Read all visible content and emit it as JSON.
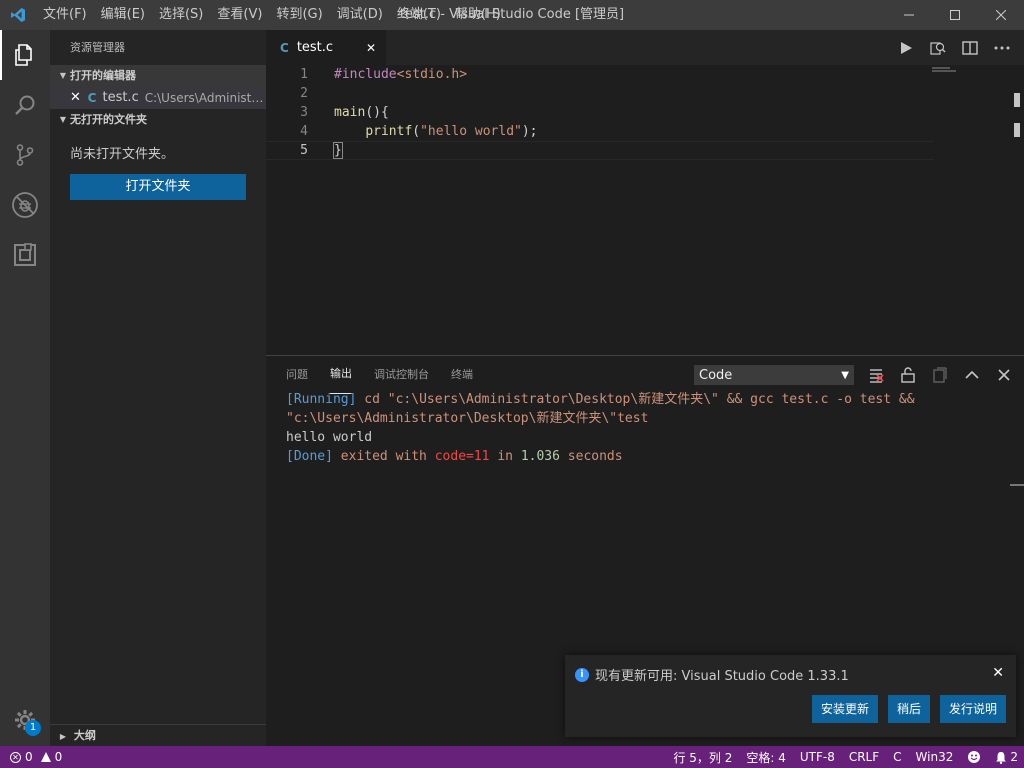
{
  "window": {
    "title": "test.c - Visual Studio Code [管理员]",
    "menu": [
      "文件(F)",
      "编辑(E)",
      "选择(S)",
      "查看(V)",
      "转到(G)",
      "调试(D)",
      "终端(T)",
      "帮助(H)"
    ]
  },
  "activitybar": {
    "items": [
      "explorer-icon",
      "search-icon",
      "source-control-icon",
      "debug-icon",
      "extensions-icon"
    ],
    "gear_badge": "1"
  },
  "sidebar": {
    "title": "资源管理器",
    "open_editors_header": "打开的编辑器",
    "open_editor": {
      "close": "✕",
      "lang_icon": "C",
      "name": "test.c",
      "path": "C:\\Users\\Administrator\\Desktop\\新建文件夹"
    },
    "no_folder_header": "无打开的文件夹",
    "no_folder_msg": "尚未打开文件夹。",
    "open_folder_button": "打开文件夹",
    "outline_header": "大纲"
  },
  "editor": {
    "tab": {
      "lang_icon": "C",
      "name": "test.c",
      "close": "✕"
    },
    "line_numbers": [
      "1",
      "2",
      "3",
      "4",
      "5"
    ],
    "code": {
      "l1_directive": "#include",
      "l1_header": "<stdio.h>",
      "l3_fn": "main",
      "l3_punc": "(){",
      "l4_indent": "    ",
      "l4_fn": "printf",
      "l4_open": "(",
      "l4_str": "\"hello world\"",
      "l4_close": ");",
      "l5_brace": "}"
    }
  },
  "panel": {
    "tabs": [
      "问题",
      "输出",
      "调试控制台",
      "终端"
    ],
    "active_tab": "输出",
    "output_channel": "Code",
    "output": {
      "l1_tag": "[Running]",
      "l1_cmd": " cd \"c:\\Users\\Administrator\\Desktop\\新建文件夹\\\" && gcc test.c -o test &&",
      "l2_cmd": "\"c:\\Users\\Administrator\\Desktop\\新建文件夹\\\"test",
      "l3": "hello world",
      "l4_tag": "[Done]",
      "l4_a": " exited with ",
      "l4_code": "code=11",
      "l4_b": " in ",
      "l4_time": "1.036",
      "l4_c": " seconds"
    }
  },
  "notification": {
    "message": "现有更新可用: Visual Studio Code 1.33.1",
    "buttons": [
      "安装更新",
      "稍后",
      "发行说明"
    ],
    "close": "✕"
  },
  "statusbar": {
    "errors": "0",
    "warnings": "0",
    "position": "行 5，列 2",
    "spaces": "空格: 4",
    "encoding": "UTF-8",
    "eol": "CRLF",
    "language": "C",
    "platform": "Win32",
    "notifications": "2",
    "colors": {
      "background": "#68217a"
    }
  }
}
